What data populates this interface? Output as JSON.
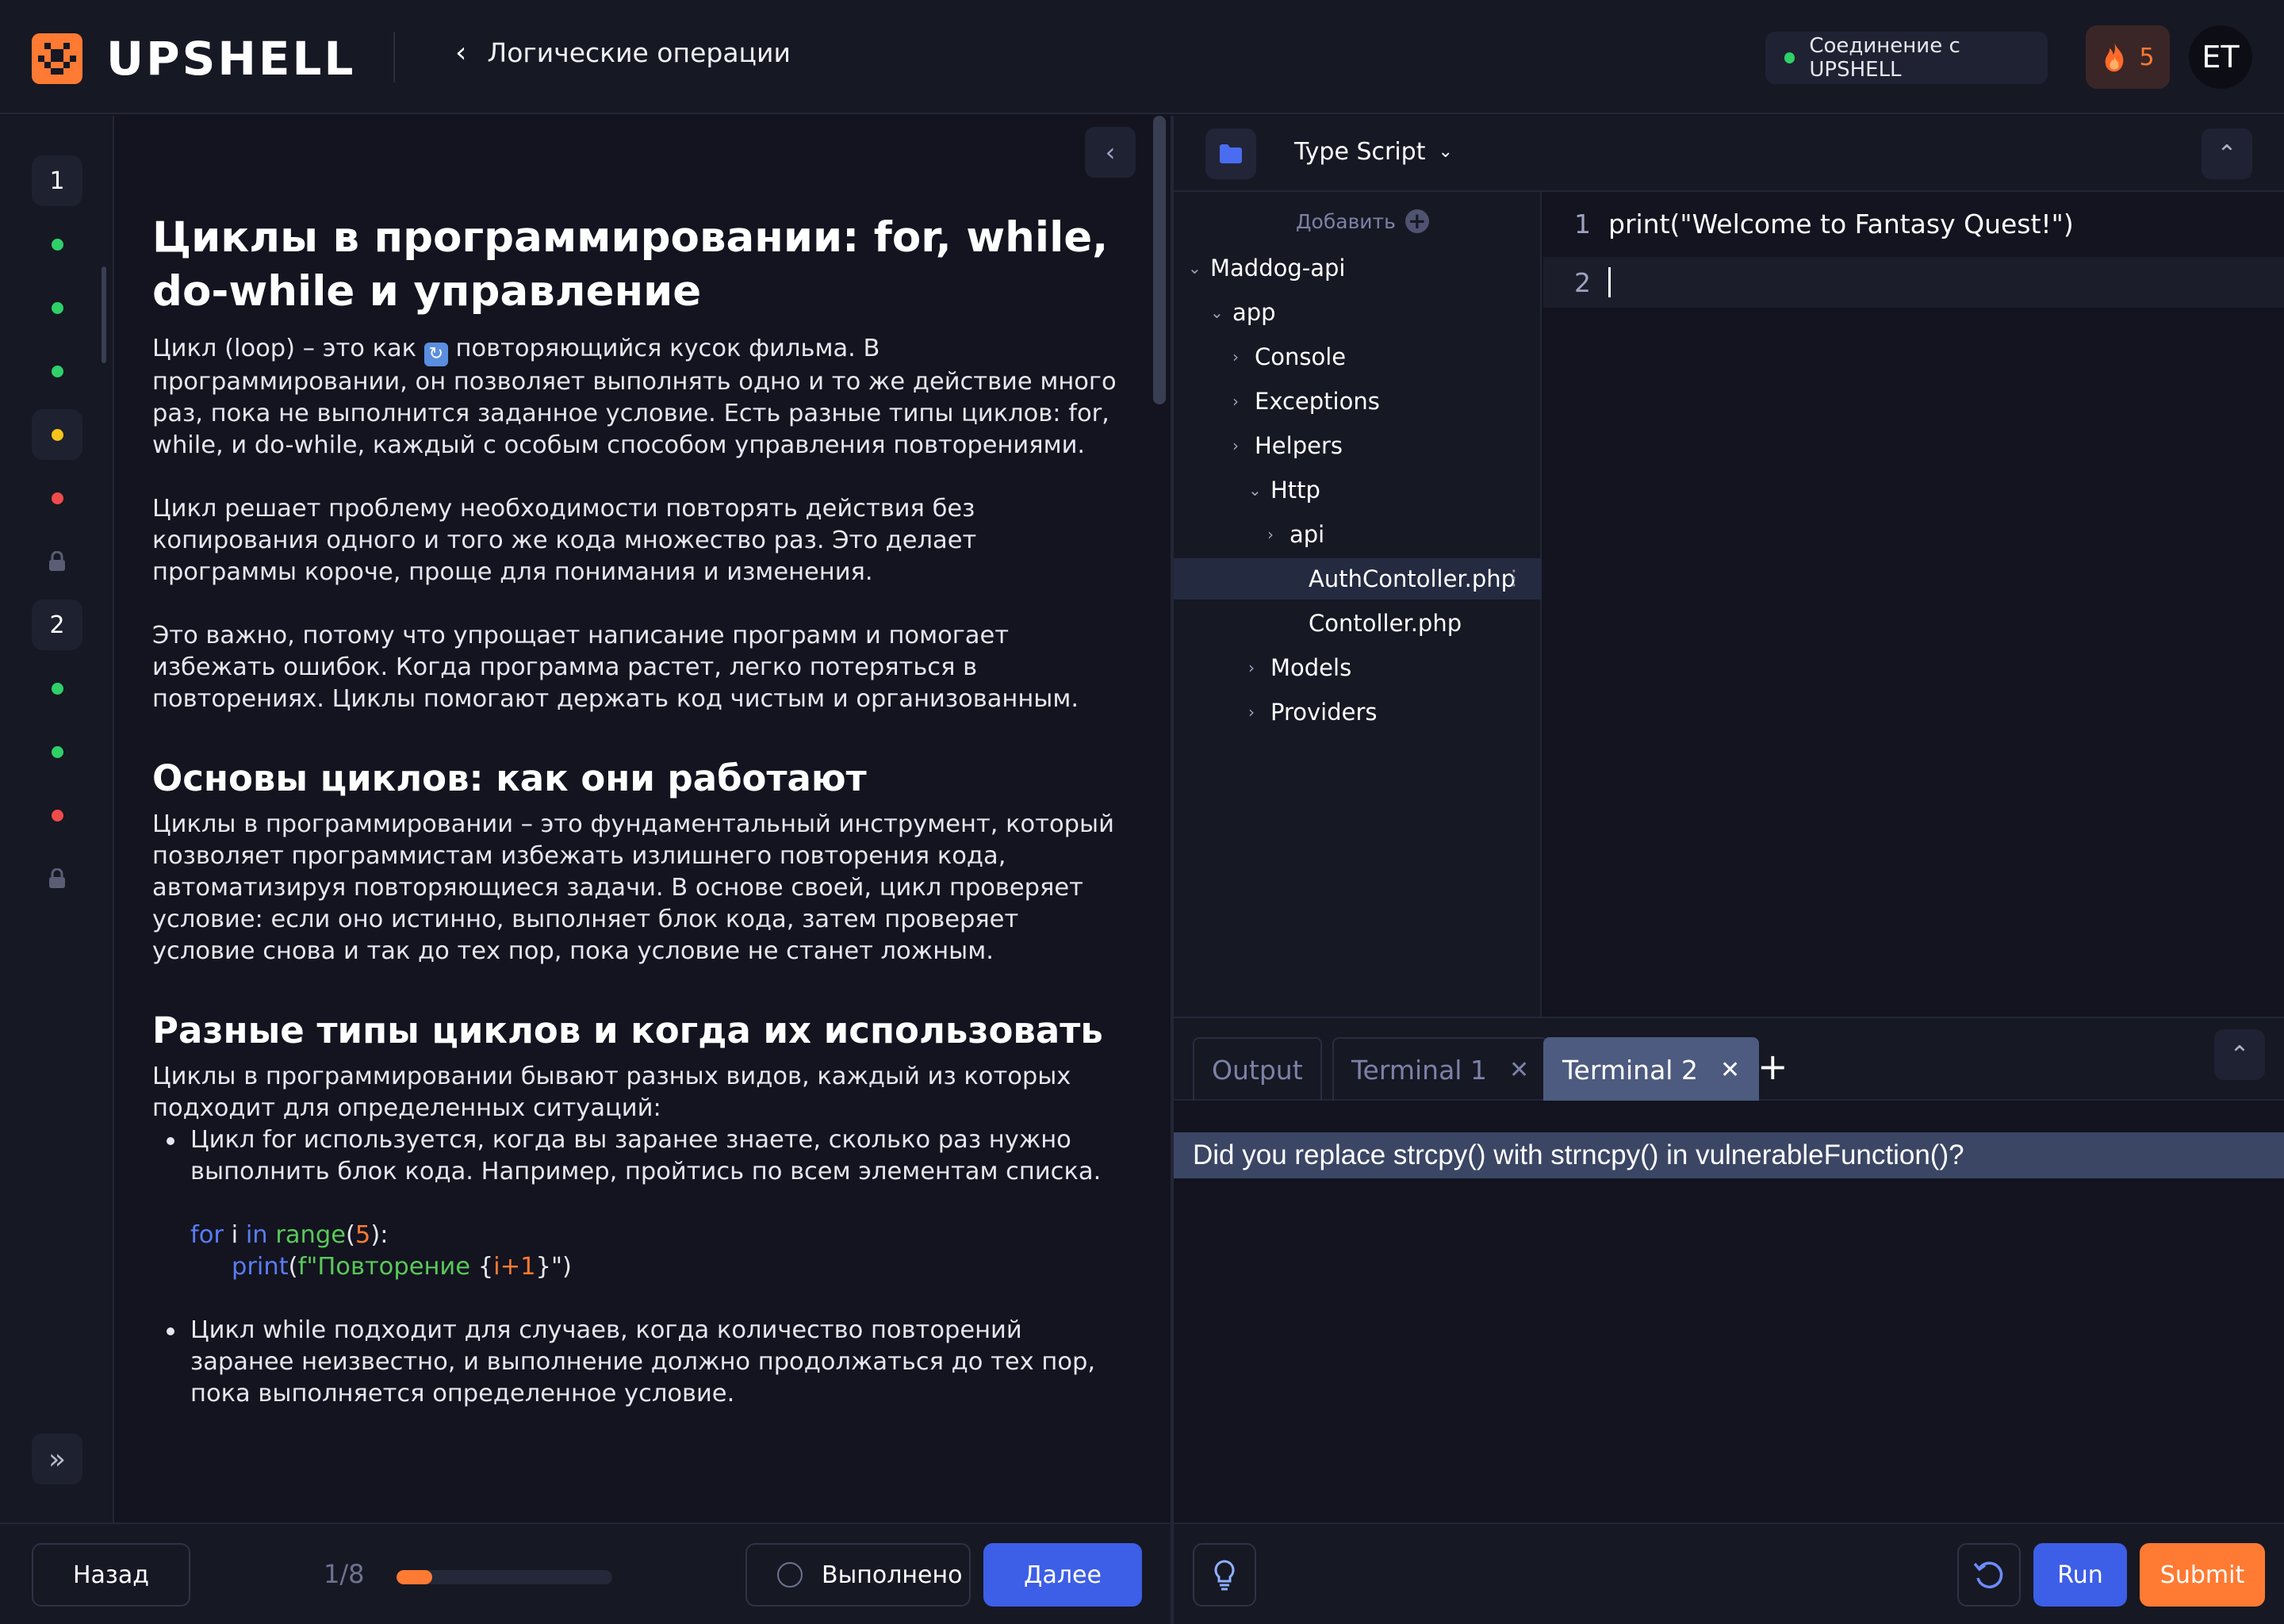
{
  "app": {
    "name": "UPSHELL"
  },
  "header": {
    "breadcrumb": "Логические операции",
    "connection": "Соединение с UPSHELL",
    "streak": "5",
    "avatar": "ET"
  },
  "rail": {
    "steps": [
      {
        "label": "1"
      },
      {
        "status": "done",
        "color": "#2fd068"
      },
      {
        "status": "done",
        "color": "#2fd068"
      },
      {
        "status": "done",
        "color": "#2fd068"
      },
      {
        "status": "current",
        "color": "#f5c518"
      },
      {
        "status": "failed",
        "color": "#ef4b4b"
      },
      {
        "status": "locked"
      },
      {
        "label": "2"
      },
      {
        "status": "done",
        "color": "#2fd068"
      },
      {
        "status": "done",
        "color": "#2fd068"
      },
      {
        "status": "failed",
        "color": "#ef4b4b"
      },
      {
        "status": "locked"
      }
    ]
  },
  "article": {
    "title": "Циклы в программировании: for, while, do-while и управление",
    "p1a": "Цикл (loop) – это как ",
    "p1b": " повторяющийся кусок фильма. В программировании, он позволяет выполнять одно и то же действие много раз, пока не выполнится заданное условие. Есть разные типы циклов: for, while, и do-while, каждый с особым способом управления повторениями.",
    "p2": "Цикл решает проблему необходимости повторять действия без копирования одного и того же кода множество раз. Это делает программы короче, проще для понимания и изменения.",
    "p3": "Это важно, потому что упрощает написание программ и помогает избежать ошибок. Когда программа растет, легко потеряться в повторениях. Циклы помогают держать код чистым и организованным.",
    "h2a": "Основы циклов: как они работают",
    "p4": "Циклы в программировании – это фундаментальный инструмент, который позволяет программистам избежать излишнего повторения кода, автоматизируя повторяющиеся задачи. В основе своей, цикл проверяет условие: если оно истинно, выполняет блок кода, затем проверяет условие снова и так до тех пор, пока условие не станет ложным.",
    "h2b": "Разные типы циклов и когда их использовать",
    "p5": "Циклы в программировании бывают разных видов, каждый из которых подходит для определенных ситуаций:",
    "li1": "Цикл for используется, когда вы заранее знаете, сколько раз нужно выполнить блок кода. Например, пройтись по всем элементам списка.",
    "code": {
      "for": "for",
      "i": " i ",
      "in": "in",
      "range": " range",
      "open": "(",
      "five": "5",
      "close": "):",
      "print": "print",
      "popen": "(",
      "fstr": "f\"Повторение ",
      "lbrace": "{",
      "expr": "i+1",
      "rbrace": "}",
      "qend": "\")"
    },
    "li2": "Цикл while подходит для случаев,  когда количество повторений заранее неизвестно, и выполнение должно  продолжаться до тех пор, пока выполняется определенное условие."
  },
  "footer_left": {
    "back": "Назад",
    "progress_text": "1/8",
    "progress_fraction": 0.167,
    "done": "Выполнено",
    "next": "Далее"
  },
  "editor": {
    "language": "Type Script",
    "add_label": "Добавить",
    "tree": [
      {
        "label": "Maddog-api",
        "arrow": "⌄",
        "depth": 0
      },
      {
        "label": "app",
        "arrow": "⌄",
        "depth": 1
      },
      {
        "label": "Console",
        "arrow": "›",
        "depth": 2
      },
      {
        "label": "Exceptions",
        "arrow": "›",
        "depth": 2
      },
      {
        "label": "Helpers",
        "arrow": "›",
        "depth": 2
      },
      {
        "label": "Http",
        "arrow": "⌄",
        "depth": 3
      },
      {
        "label": "api",
        "arrow": "›",
        "depth": 4
      },
      {
        "label": "AuthContoller.php",
        "arrow": "",
        "depth": 5,
        "selected": true
      },
      {
        "label": "Contoller.php",
        "arrow": "",
        "depth": 5
      },
      {
        "label": "Models",
        "arrow": "›",
        "depth": 3
      },
      {
        "label": "Providers",
        "arrow": "›",
        "depth": 3
      }
    ],
    "lines": [
      {
        "num": "1",
        "text": "print(\"Welcome to Fantasy Quest!\")"
      },
      {
        "num": "2",
        "text": ""
      }
    ]
  },
  "terminal": {
    "tabs": [
      {
        "label": "Output",
        "closable": false,
        "active": false
      },
      {
        "label": "Terminal 1",
        "closable": true,
        "active": false
      },
      {
        "label": "Terminal 2",
        "closable": true,
        "active": true
      }
    ],
    "message": "Did you replace strcpy() with strncpy() in vulnerableFunction()?"
  },
  "footer_right": {
    "run": "Run",
    "submit": "Submit"
  }
}
